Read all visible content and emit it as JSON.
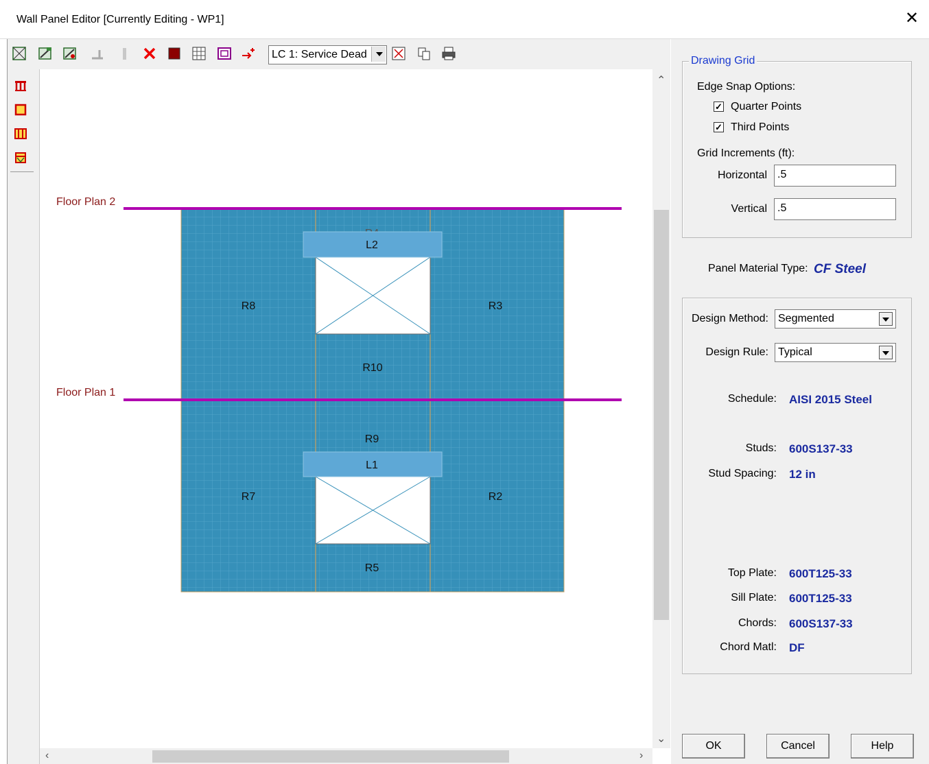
{
  "window": {
    "title": "Wall Panel Editor  [Currently Editing - WP1]"
  },
  "toolbar": {
    "load_case_select": "LC 1: Service Dead",
    "icons": [
      "select-all-icon",
      "edit-region-icon",
      "edit-region-alt-icon",
      "opening-icon",
      "divider-icon",
      "delete-icon",
      "fill-icon",
      "grid-icon",
      "frame-icon",
      "insert-point-icon",
      "zoom-fit-icon",
      "copy-icon",
      "print-icon"
    ]
  },
  "left_tools": [
    "wall-tool-1-icon",
    "wall-tool-2-icon",
    "wall-tool-3-icon",
    "wall-tool-4-icon"
  ],
  "drawing": {
    "floor_plans": [
      "Floor Plan 2",
      "Floor Plan 1"
    ],
    "regions": [
      "R8",
      "R4",
      "R3",
      "R10",
      "R9",
      "R7",
      "R2",
      "R5"
    ],
    "lintels": [
      "L2",
      "L1"
    ],
    "colors": {
      "panel": "#3690b9",
      "lintel": "#5ea8d6",
      "floor_line": "#b000b0",
      "floor_label": "#8b1a1a"
    }
  },
  "right_panel": {
    "drawing_grid": {
      "title": "Drawing Grid",
      "edge_snap_label": "Edge Snap Options:",
      "quarter_points": "Quarter Points",
      "third_points": "Third Points",
      "grid_increments_label": "Grid Increments (ft):",
      "horizontal_label": "Horizontal",
      "horizontal_value": ".5",
      "vertical_label": "Vertical",
      "vertical_value": ".5"
    },
    "material_label": "Panel Material Type:",
    "material_value": "CF Steel",
    "design": {
      "method_label": "Design Method:",
      "method_value": "Segmented",
      "rule_label": "Design Rule:",
      "rule_value": "Typical",
      "schedule_label": "Schedule:",
      "schedule_value": "AISI 2015 Steel",
      "studs_label": "Studs:",
      "studs_value": "600S137-33",
      "stud_spacing_label": "Stud Spacing:",
      "stud_spacing_value": "12 in",
      "top_plate_label": "Top Plate:",
      "top_plate_value": "600T125-33",
      "sill_plate_label": "Sill Plate:",
      "sill_plate_value": "600T125-33",
      "chords_label": "Chords:",
      "chords_value": "600S137-33",
      "chord_matl_label": "Chord Matl:",
      "chord_matl_value": "DF"
    },
    "buttons": {
      "ok": "OK",
      "cancel": "Cancel",
      "help": "Help"
    }
  }
}
